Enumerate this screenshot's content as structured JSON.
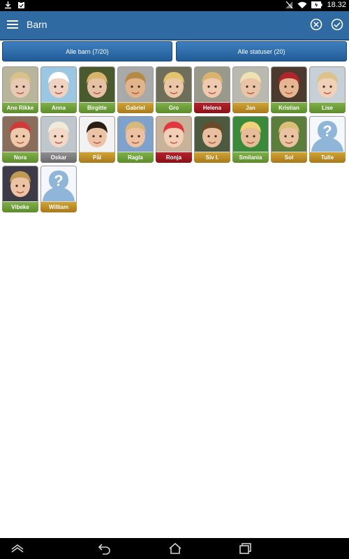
{
  "status_bar": {
    "time": "18.32"
  },
  "app_bar": {
    "title": "Barn"
  },
  "filters": {
    "children_label": "Alle barn (7/20)",
    "status_label": "Alle statuser (20)"
  },
  "children": [
    {
      "name": "Ane Rikke",
      "status": "green",
      "skin": "#e8c9b4",
      "hair": "#d9c28a",
      "bg": "#b7b59c"
    },
    {
      "name": "Anna",
      "status": "green",
      "skin": "#f0d2c2",
      "hair": "#ffffff",
      "bg": "#9cc7e3"
    },
    {
      "name": "Birgitte",
      "status": "green",
      "skin": "#e6c1a5",
      "hair": "#d8b36a",
      "bg": "#4a5a2e"
    },
    {
      "name": "Gabriel",
      "status": "gold",
      "skin": "#e2b48c",
      "hair": "#b58a46",
      "bg": "#a9a9a9"
    },
    {
      "name": "Gro",
      "status": "green",
      "skin": "#ebc7a7",
      "hair": "#e1c46d",
      "bg": "#6e6e5a"
    },
    {
      "name": "Helena",
      "status": "red",
      "skin": "#efcab0",
      "hair": "#d9b46e",
      "bg": "#9a9a8a"
    },
    {
      "name": "Jan",
      "status": "gold",
      "skin": "#e9c4a6",
      "hair": "#efe2b2",
      "bg": "#b9b9b0"
    },
    {
      "name": "Kristian",
      "status": "green",
      "skin": "#e6b592",
      "hair": "#b0252c",
      "bg": "#4d3a2e"
    },
    {
      "name": "Lise",
      "status": "green",
      "skin": "#f0d0b8",
      "hair": "#dcc389",
      "bg": "#c7d0d6"
    },
    {
      "name": "Nora",
      "status": "green",
      "skin": "#efc9ac",
      "hair": "#d23a3a",
      "bg": "#8a6d5a"
    },
    {
      "name": "Oskar",
      "status": "grey",
      "skin": "#f3d8c8",
      "hair": "#f0ead8",
      "bg": "#bfc7cc"
    },
    {
      "name": "Pål",
      "status": "gold",
      "skin": "#ecc3a6",
      "hair": "#2a1d16",
      "bg": "#f2f2f2"
    },
    {
      "name": "Ragla",
      "status": "green",
      "skin": "#ecc2a3",
      "hair": "#d4b87c",
      "bg": "#7ea2cc"
    },
    {
      "name": "Ronja",
      "status": "red",
      "skin": "#f2cfb6",
      "hair": "#e0383e",
      "bg": "#c9b29a"
    },
    {
      "name": "Siv I.",
      "status": "gold",
      "skin": "#e8bf9f",
      "hair": "#6b4a2c",
      "bg": "#4c5a40"
    },
    {
      "name": "Smilania",
      "status": "green",
      "skin": "#e7bc98",
      "hair": "#f0d27a",
      "bg": "#3b8a3b"
    },
    {
      "name": "Sol",
      "status": "gold",
      "skin": "#e9c3a2",
      "hair": "#d9bf78",
      "bg": "#5c7e3c"
    },
    {
      "name": "Tulle",
      "status": "gold",
      "placeholder": true
    },
    {
      "name": "Vibeke",
      "status": "green",
      "skin": "#ecc4a4",
      "hair": "#bf9a55",
      "bg": "#3e3a48"
    },
    {
      "name": "William",
      "status": "gold",
      "placeholder": true
    }
  ],
  "colors": {
    "app_bar": "#2f6aa3",
    "status_green": "#6e9e38",
    "status_gold": "#be8d26",
    "status_red": "#a01a20",
    "status_grey": "#7e7e7e"
  },
  "icons": {
    "menu": "hamburger-menu-icon",
    "cancel": "cancel-circle-icon",
    "confirm": "check-circle-icon",
    "placeholder": "unknown-person-icon",
    "nav": [
      "chevron-up-icon",
      "back-icon",
      "home-icon",
      "recent-apps-icon"
    ]
  }
}
